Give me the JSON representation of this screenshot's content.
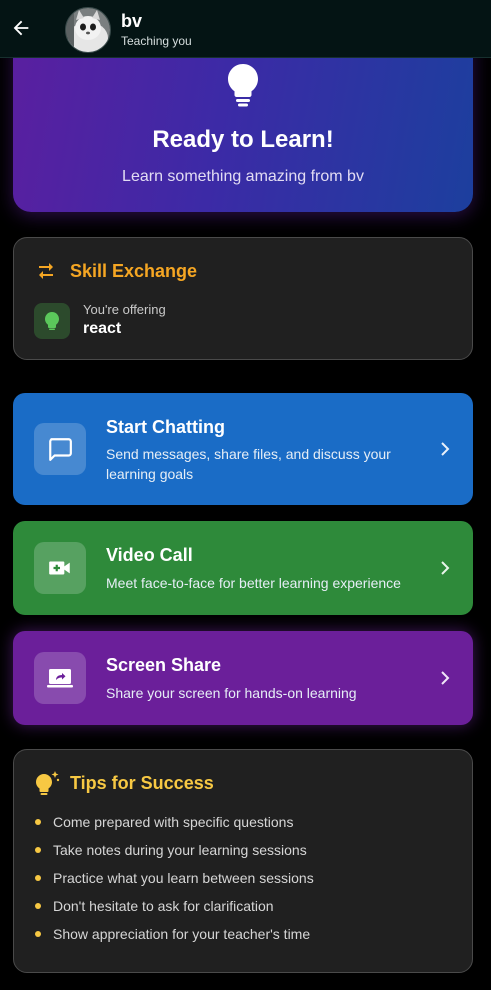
{
  "header": {
    "back_icon": "arrow-left-icon",
    "avatar_icon": "cat-avatar",
    "name": "bv",
    "subtitle": "Teaching you"
  },
  "hero": {
    "icon": "lightbulb-icon",
    "title": "Ready to Learn!",
    "subtitle": "Learn something amazing from bv",
    "gradient": [
      "#5a1fa0",
      "#1c3f9e"
    ]
  },
  "skill_exchange": {
    "icon": "swap-arrows-icon",
    "title": "Skill Exchange",
    "title_color": "#f5a623",
    "offering_icon": "lightbulb-icon",
    "offering_label": "You're offering",
    "offering_value": "react"
  },
  "actions": [
    {
      "icon": "chat-bubble-icon",
      "title": "Start Chatting",
      "description": "Send messages, share files, and discuss your learning goals",
      "color": "#1a6cc6"
    },
    {
      "icon": "video-call-icon",
      "title": "Video Call",
      "description": "Meet face-to-face for better learning experience",
      "color": "#2e8a3a"
    },
    {
      "icon": "screen-share-icon",
      "title": "Screen Share",
      "description": "Share your screen for hands-on learning",
      "color": "#6b1f9a"
    }
  ],
  "tips": {
    "icon": "lightbulb-sparkle-icon",
    "title": "Tips for Success",
    "title_color": "#f7c843",
    "items": [
      "Come prepared with specific questions",
      "Take notes during your learning sessions",
      "Practice what you learn between sessions",
      "Don't hesitate to ask for clarification",
      "Show appreciation for your teacher's time"
    ]
  }
}
